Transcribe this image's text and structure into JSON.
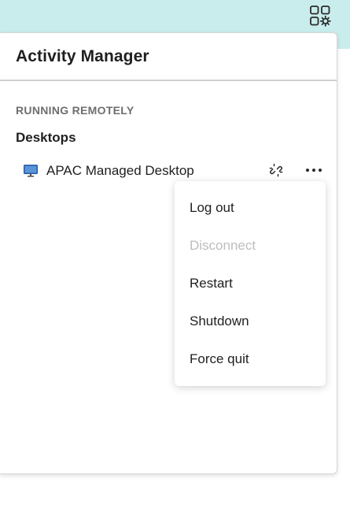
{
  "header": {
    "apps_icon": "apps-settings-icon"
  },
  "panel": {
    "title": "Activity Manager",
    "section_label": "RUNNING REMOTELY",
    "group_label": "Desktops",
    "sessions": [
      {
        "name": "APAC Managed Desktop",
        "icon": "monitor-icon",
        "disconnect_icon": "broken-link-icon",
        "more_icon": "more-horizontal-icon"
      }
    ]
  },
  "context_menu": {
    "items": [
      {
        "label": "Log out",
        "enabled": true
      },
      {
        "label": "Disconnect",
        "enabled": false
      },
      {
        "label": "Restart",
        "enabled": true
      },
      {
        "label": "Shutdown",
        "enabled": true
      },
      {
        "label": "Force quit",
        "enabled": true
      }
    ]
  },
  "colors": {
    "topbar": "#c9ecec",
    "monitor": "#3a78c9",
    "disabled_text": "#bdbdbd"
  }
}
